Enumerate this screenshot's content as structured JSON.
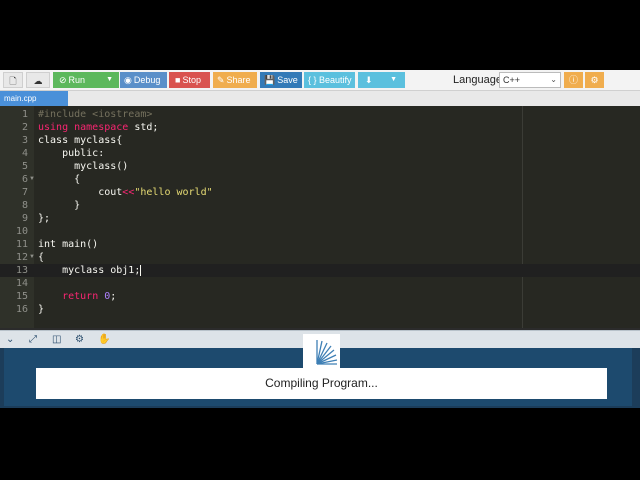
{
  "toolbar": {
    "run_label": "Run",
    "debug_label": "Debug",
    "stop_label": "Stop",
    "share_label": "Share",
    "save_label": "Save",
    "beautify_label": "{ } Beautify",
    "language_label": "Language",
    "language_value": "C++"
  },
  "colors": {
    "run": "#5cb85c",
    "debug": "#5a8fc9",
    "stop": "#d9534f",
    "share": "#f0ad4e",
    "save": "#337ab7",
    "beautify": "#5bc0de",
    "download": "#5bc0de",
    "info": "#f0ad4e",
    "settings": "#f0ad4e",
    "editor_bg": "#272822",
    "console_bg": "#1d4a6e"
  },
  "tab": {
    "filename": "main.cpp"
  },
  "editor": {
    "line_numbers": [
      "1",
      "2",
      "3",
      "4",
      "5",
      "6",
      "7",
      "8",
      "9",
      "10",
      "11",
      "12",
      "13",
      "14",
      "15",
      "16"
    ]
  },
  "console": {
    "status": "Compiling Program..."
  }
}
